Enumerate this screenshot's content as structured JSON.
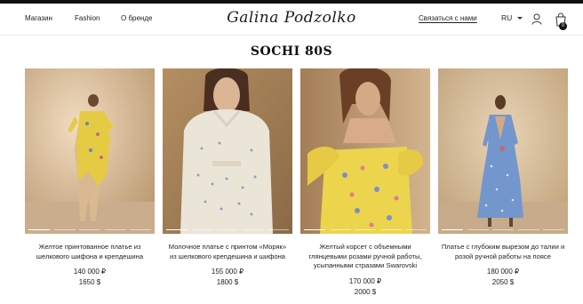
{
  "header": {
    "nav": [
      "Магазин",
      "Fashion",
      "О бренде"
    ],
    "logo": "Galina Podzolko",
    "contact": "Связаться с нами",
    "lang": "RU",
    "cart_count": "0"
  },
  "collection": {
    "title": "SOCHI 80S"
  },
  "products": [
    {
      "name": "Желтое принтованное платье из шелкового шифона и крепдешина",
      "price_rub": "140 000 ₽",
      "price_usd": "1650 $"
    },
    {
      "name": "Молочное платье с принтом «Моряк» из шелкового крепдешина и шифона",
      "price_rub": "155 000 ₽",
      "price_usd": "1800 $"
    },
    {
      "name": "Желтый корсет с объемными глянцевыми розами ручной работы, усыпанными стразами Swarovski",
      "price_rub": "170 000 ₽",
      "price_usd": "2000 $"
    },
    {
      "name": "Платье с глубоким вырезом до талии и розой ручной работы на поясе",
      "price_rub": "180 000 ₽",
      "price_usd": "2050 $"
    }
  ],
  "colors": {
    "accent": "#111111",
    "photo_bg_warm": "#c9a67e",
    "dress_yellow": "#e8cf4a",
    "dress_blue": "#6f8fc4",
    "dress_cream": "#e9e2d4"
  },
  "icons": [
    "user-icon",
    "cart-icon",
    "chevron-down-icon"
  ]
}
